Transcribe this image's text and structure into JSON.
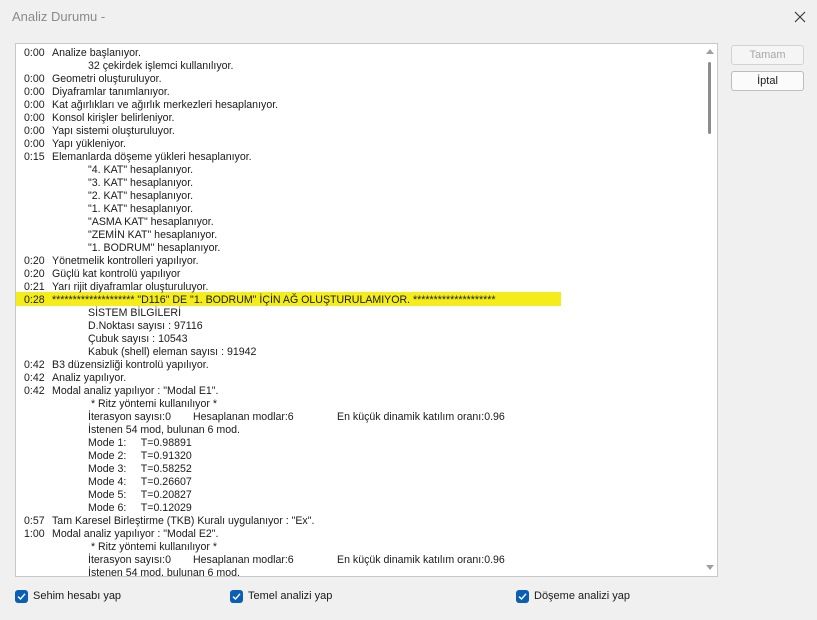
{
  "window": {
    "title": "Analiz Durumu -"
  },
  "buttons": {
    "ok_label": "Tamam",
    "cancel_label": "İptal"
  },
  "checkboxes": [
    {
      "label": "Sehim hesabı yap",
      "checked": true
    },
    {
      "label": "Temel analizi yap",
      "checked": true
    },
    {
      "label": "Döşeme analizi yap",
      "checked": true
    }
  ],
  "log": [
    {
      "time": "0:00",
      "text": "Analize başlanıyor."
    },
    {
      "time": "",
      "text": "32 çekirdek işlemci kullanılıyor."
    },
    {
      "time": "0:00",
      "text": "Geometri oluşturuluyor."
    },
    {
      "time": "0:00",
      "text": "Diyaframlar tanımlanıyor."
    },
    {
      "time": "0:00",
      "text": "Kat ağırlıkları ve ağırlık merkezleri hesaplanıyor."
    },
    {
      "time": "0:00",
      "text": "Konsol kirişler belirleniyor."
    },
    {
      "time": "0:00",
      "text": "Yapı sistemi oluşturuluyor."
    },
    {
      "time": "0:00",
      "text": "Yapı yükleniyor."
    },
    {
      "time": "0:15",
      "text": "Elemanlarda döşeme yükleri hesaplanıyor."
    },
    {
      "time": "",
      "text": "\"4. KAT\" hesaplanıyor."
    },
    {
      "time": "",
      "text": "\"3. KAT\" hesaplanıyor."
    },
    {
      "time": "",
      "text": "\"2. KAT\" hesaplanıyor."
    },
    {
      "time": "",
      "text": "\"1. KAT\" hesaplanıyor."
    },
    {
      "time": "",
      "text": "\"ASMA KAT\" hesaplanıyor."
    },
    {
      "time": "",
      "text": "\"ZEMİN KAT\" hesaplanıyor."
    },
    {
      "time": "",
      "text": "\"1. BODRUM\" hesaplanıyor."
    },
    {
      "time": "0:20",
      "text": "Yönetmelik kontrolleri yapılıyor."
    },
    {
      "time": "0:20",
      "text": "Güçlü kat kontrolü yapılıyor"
    },
    {
      "time": "0:21",
      "text": "Yarı rijit diyaframlar oluşturuluyor."
    },
    {
      "time": "0:28",
      "text": "******************** \"D116\" DE \"1. BODRUM\" İÇİN AĞ OLUŞTURULAMIYOR. ********************"
    },
    {
      "time": "",
      "text": "SİSTEM BİLGİLERİ"
    },
    {
      "time": "",
      "text": "D.Noktası sayısı : 97116"
    },
    {
      "time": "",
      "text": "Çubuk sayısı : 10543"
    },
    {
      "time": "",
      "text": "Kabuk (shell) eleman sayısı : 91942"
    },
    {
      "time": "0:42",
      "text": "B3 düzensizliği kontrolü yapılıyor."
    },
    {
      "time": "0:42",
      "text": "Analiz yapılıyor."
    },
    {
      "time": "0:42",
      "text": "Modal analiz yapılıyor : \"Modal E1\"."
    },
    {
      "time": "",
      "text": " * Ritz yöntemi kullanılıyor *"
    },
    {
      "time": "",
      "text": "İterasyon sayısı:0",
      "col2": "Hesaplanan modlar:6",
      "col3": "En küçük dinamik katılım oranı:0.96"
    },
    {
      "time": "",
      "text": "İstenen 54 mod, bulunan 6 mod."
    },
    {
      "time": "",
      "text": "Mode 1:     T=0.98891"
    },
    {
      "time": "",
      "text": "Mode 2:     T=0.91320"
    },
    {
      "time": "",
      "text": "Mode 3:     T=0.58252"
    },
    {
      "time": "",
      "text": "Mode 4:     T=0.26607"
    },
    {
      "time": "",
      "text": "Mode 5:     T=0.20827"
    },
    {
      "time": "",
      "text": "Mode 6:     T=0.12029"
    },
    {
      "time": "0:57",
      "text": "Tam Karesel Birleştirme (TKB) Kuralı uygulanıyor : \"Ex\"."
    },
    {
      "time": "1:00",
      "text": "Modal analiz yapılıyor : \"Modal E2\"."
    },
    {
      "time": "",
      "text": " * Ritz yöntemi kullanılıyor *"
    },
    {
      "time": "",
      "text": "İterasyon sayısı:0",
      "col2": "Hesaplanan modlar:6",
      "col3": "En küçük dinamik katılım oranı:0.96"
    },
    {
      "time": "",
      "text": "İstenen 54 mod, bulunan 6 mod."
    }
  ],
  "highlight_color": "#f4ed1b",
  "accent_color": "#0a5fb4"
}
